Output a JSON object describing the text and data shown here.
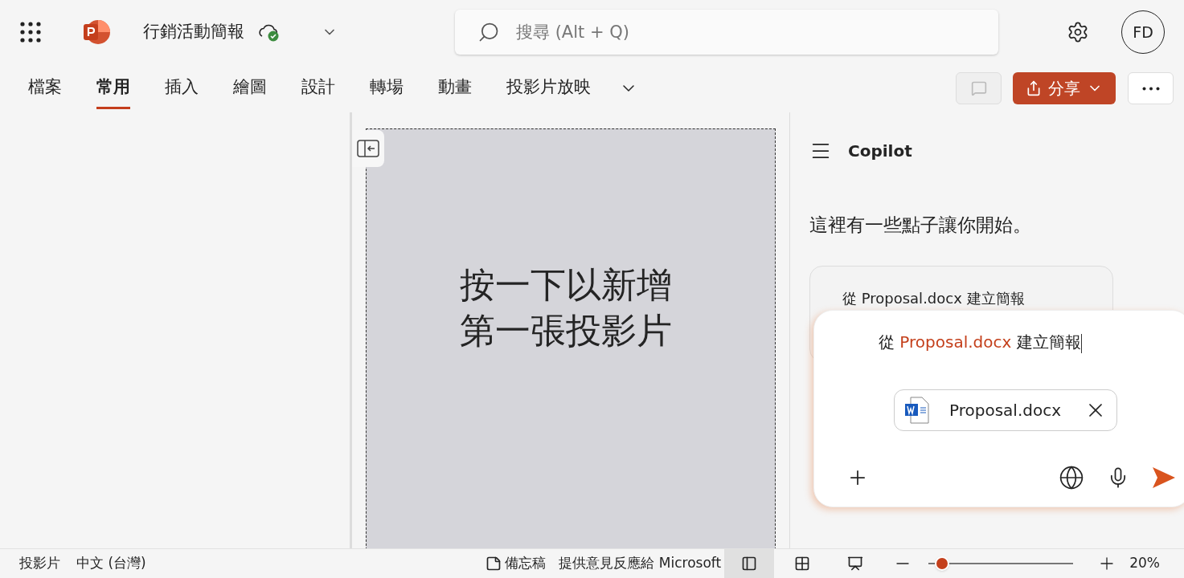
{
  "app": {
    "document_title": "行銷活動簡報",
    "search": {
      "placeholder": "搜尋 (Alt + Q)"
    },
    "avatar": "FD"
  },
  "tabs": [
    {
      "label": "檔案",
      "selected": false
    },
    {
      "label": "常用",
      "selected": true
    },
    {
      "label": "插入",
      "selected": false
    },
    {
      "label": "繪圖",
      "selected": false
    },
    {
      "label": "設計",
      "selected": false
    },
    {
      "label": "轉場",
      "selected": false
    },
    {
      "label": "動畫",
      "selected": false
    },
    {
      "label": "投影片放映",
      "selected": false
    }
  ],
  "share_button": "分享",
  "slide": {
    "placeholder": "按一下以新增第一張投影片"
  },
  "copilot": {
    "title": "Copilot",
    "intro": "這裡有一些點子讓你開始。",
    "suggestion": "從 Proposal.docx 建立簡報",
    "prompt": {
      "before": "從 ",
      "mention": "Proposal.docx",
      "after": " 建立簡報"
    },
    "attachment": "Proposal.docx"
  },
  "status_bar": {
    "slide_label": "投影片",
    "language": "中文 (台灣)",
    "notes": "備忘稿",
    "feedback": "提供意見反應給 Microsoft",
    "views": [
      {
        "kind": "normal",
        "selected": true
      },
      {
        "kind": "sorter",
        "selected": false
      },
      {
        "kind": "reading",
        "selected": false
      }
    ],
    "zoom": {
      "level": 0.05,
      "reading": "20%"
    }
  }
}
